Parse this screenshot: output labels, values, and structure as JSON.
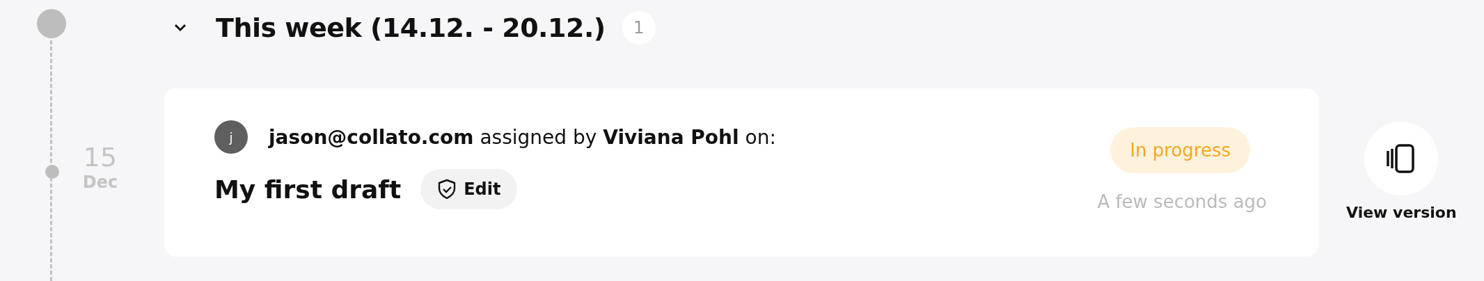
{
  "section": {
    "title": "This week (14.12. - 20.12.)",
    "count": "1",
    "expanded": true
  },
  "timeline": {
    "day": "15",
    "month": "Dec"
  },
  "entries": [
    {
      "avatar_letter": "j",
      "sentence": "**jason@collato.com** assigned by **Viviana Pohl** on:",
      "title": "My first draft",
      "action": "Edit",
      "status": "In progress",
      "time": "A few seconds ago",
      "side_action": "View version"
    }
  ]
}
